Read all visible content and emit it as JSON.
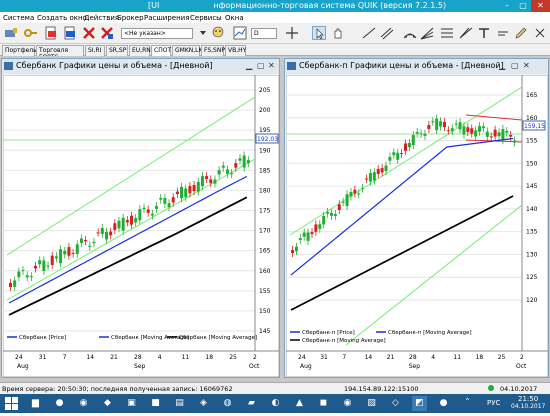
{
  "titlebar": {
    "title_prefix": "[UI",
    "title": "нформационно-торговая система QUIK (версия 7.2.1.5)"
  },
  "menu": [
    "Система",
    "Создать окно",
    "Действия",
    "Брокер",
    "Расширения",
    "Сервисы",
    "Окна"
  ],
  "toolbar": {
    "account_select": "<Не указан>",
    "interval_select": "D"
  },
  "tabs": [
    "Портфель",
    "Торговля FORTS",
    "SI,RI",
    "SR,SP",
    "EU,RN",
    "СПОТ",
    "GMKN,LK",
    "FS,SNP",
    "VB,HY"
  ],
  "active_tab": "СПОТ",
  "chart_left": {
    "window_title": "Сбербанк Графики цены и объема - [Дневной]",
    "last_price_label": "192,03",
    "y_ticks": [
      "205",
      "200",
      "195",
      "190",
      "185",
      "180",
      "175",
      "170",
      "165",
      "160",
      "155",
      "150",
      "145"
    ],
    "x_ticks": [
      "24",
      "31",
      "7",
      "14",
      "21",
      "28",
      "4",
      "11",
      "18",
      "25",
      "2"
    ],
    "month_labels": [
      "Aug",
      "Sep",
      "Oct"
    ],
    "legend": [
      "Сбербанк [Price]",
      "Сбербанк [Moving Average]",
      "Сбербанк [Moving Average]"
    ]
  },
  "chart_right": {
    "window_title": "Сбербанк-п Графики цены и объема - [Дневной]",
    "last_price_label": "159,15",
    "y_ticks": [
      "165",
      "160",
      "155",
      "150",
      "145",
      "140",
      "135",
      "130",
      "125",
      "120"
    ],
    "x_ticks": [
      "24",
      "31",
      "7",
      "14",
      "21",
      "28",
      "4",
      "11",
      "18",
      "25",
      "2"
    ],
    "month_labels": [
      "Aug",
      "Sep",
      "Oct"
    ],
    "legend": [
      "Сбербанк-п [Price]",
      "Сбербанк-п [Moving Average]",
      "Сбербанк-п [Moving Average]"
    ]
  },
  "status": {
    "server_time": "Время сервера: 20:50:30; последняя полученная запись: 16069762",
    "connection": "194.154.89.122:15100",
    "date": "04.10.2017"
  },
  "taskbar": {
    "lang": "РУС",
    "clock_time": "21:50",
    "clock_date": "04.10.2017"
  },
  "colors": {
    "bull": "#1fae32",
    "bear": "#d62020",
    "ma_fast": "#1830d8",
    "ma_slow": "#000000",
    "channel": "#6cf06c",
    "level": "#8fe88f",
    "resist": "#e03030"
  }
}
